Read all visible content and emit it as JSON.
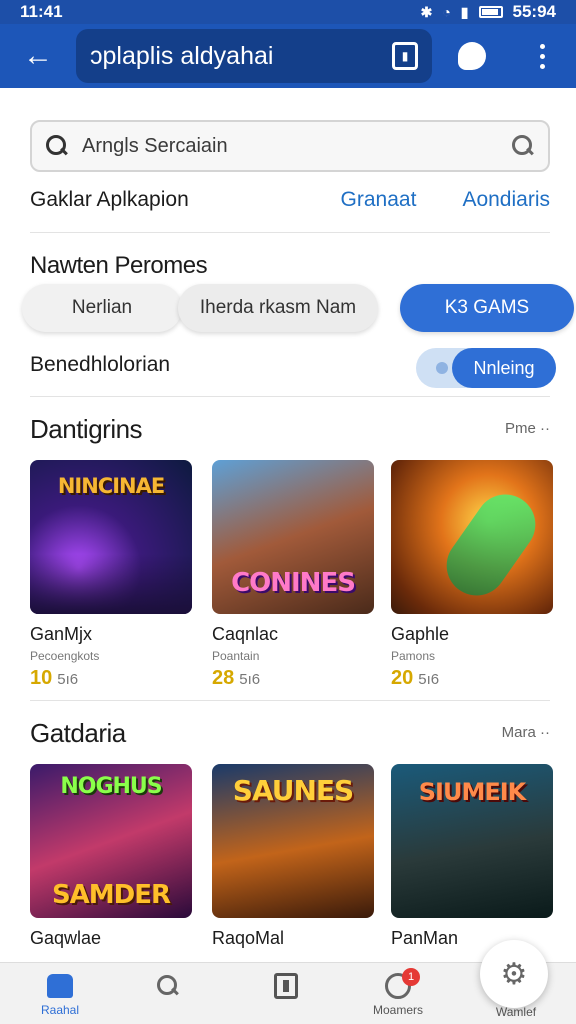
{
  "status": {
    "time_left": "11:41",
    "time_right": "55:94"
  },
  "appbar": {
    "title": "ɔplaplis aldyahai"
  },
  "search": {
    "placeholder": "Arngls Sercaiain"
  },
  "filter_row": {
    "label": "Gaklar Aplkapion",
    "link1": "Granaat",
    "link2": "Aondiaris"
  },
  "section_filters": {
    "title": "Nawten Peromes",
    "chips": [
      "Nerlian",
      "Iherda rkasm Nam",
      "K3 GAMS"
    ]
  },
  "benef": {
    "label": "Benedhlolorian",
    "toggle": "Nnleing"
  },
  "section1": {
    "title": "Dantigrins",
    "more": "Pme ··",
    "items": [
      {
        "name": "GanMjx",
        "sub": "Pecoengkots",
        "price": "10",
        "unit": "5ı6",
        "art": "NINCINAE"
      },
      {
        "name": "Caqnlac",
        "sub": "Poantain",
        "price": "28",
        "unit": "5ı6",
        "art": "CONINES"
      },
      {
        "name": "Gaphle",
        "sub": "Pamons",
        "price": "20",
        "unit": "5ı6",
        "art": ""
      }
    ]
  },
  "section2": {
    "title": "Gatdaria",
    "more": "Mara ··",
    "items": [
      {
        "name": "Gaqwlae",
        "art": "SAMDER",
        "art_top": "NOGHUS"
      },
      {
        "name": "RaqoMal",
        "art": "SAUNES",
        "art_top": ""
      },
      {
        "name": "PanMan",
        "art": "SIUMEIK",
        "art_top": ""
      }
    ]
  },
  "nav": {
    "home": "Raahal",
    "mid": "Moamers",
    "right": "Wamlef",
    "badge": "1"
  },
  "colors": {
    "primary": "#1d56b8",
    "accent": "#2f6fd6",
    "price": "#d6a800"
  }
}
